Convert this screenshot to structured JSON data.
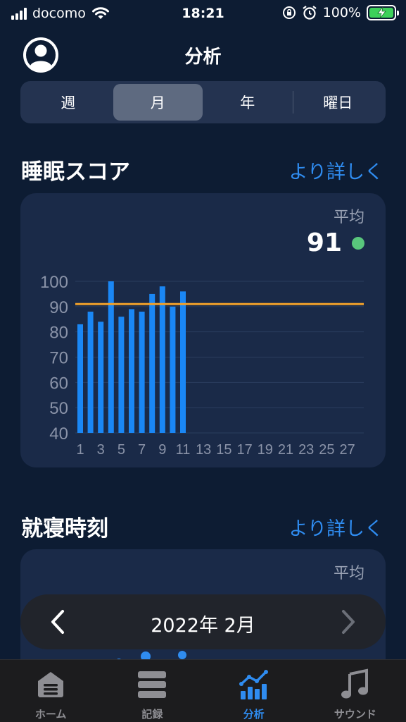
{
  "status_bar": {
    "carrier": "docomo",
    "time": "18:21",
    "battery": "100%"
  },
  "header": {
    "title": "分析"
  },
  "period_tabs": [
    "週",
    "月",
    "年",
    "曜日"
  ],
  "active_period_index": 1,
  "sleep_score": {
    "title": "睡眠スコア",
    "more": "より詳しく",
    "avg_label": "平均",
    "avg_value": "91",
    "status_color": "#59c67c"
  },
  "bedtime": {
    "title": "就寝時刻",
    "more": "より詳しく",
    "avg_label": "平均"
  },
  "month_nav": {
    "label": "2022年 2月"
  },
  "tab_bar": {
    "items": [
      {
        "label": "ホーム",
        "icon": "home-icon"
      },
      {
        "label": "記録",
        "icon": "records-icon"
      },
      {
        "label": "分析",
        "icon": "analysis-icon"
      },
      {
        "label": "サウンド",
        "icon": "music-note-icon"
      }
    ],
    "active_index": 2
  },
  "colors": {
    "accent": "#2f8cf0",
    "bar": "#1a87f5",
    "average_line": "#f0a02a",
    "background": "#0d1c33",
    "card": "#1a2a48"
  },
  "chart_data": {
    "type": "bar",
    "categories": [
      1,
      2,
      3,
      4,
      5,
      6,
      7,
      8,
      9,
      10,
      11,
      12,
      13,
      14,
      15,
      16,
      17,
      18,
      19,
      20,
      21,
      22,
      23,
      24,
      25,
      26,
      27,
      28
    ],
    "values": [
      83,
      88,
      84,
      100,
      86,
      89,
      88,
      95,
      98,
      90,
      96
    ],
    "x_tick_labels": [
      "1",
      "3",
      "5",
      "7",
      "9",
      "11",
      "13",
      "15",
      "17",
      "19",
      "21",
      "23",
      "25",
      "27"
    ],
    "y_ticks": [
      40,
      50,
      60,
      70,
      80,
      90,
      100
    ],
    "ylim": [
      40,
      100
    ],
    "average": 91,
    "grid": true
  }
}
